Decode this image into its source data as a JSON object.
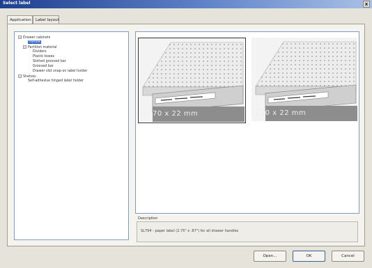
{
  "window": {
    "title": "Select label",
    "close_label": "x"
  },
  "tabs": [
    {
      "label": "Application",
      "active": true
    },
    {
      "label": "Label layout",
      "active": false
    }
  ],
  "tree": [
    {
      "label": "Drawer cabinets",
      "expander": "−"
    },
    {
      "label": "Handle",
      "selected": true
    },
    {
      "label": "Partition material",
      "expander": "−"
    },
    {
      "label": "Dividers"
    },
    {
      "label": "Plastic boxes"
    },
    {
      "label": "Slotted grooved bar"
    },
    {
      "label": "Grooved bar"
    },
    {
      "label": "Drawer slot snap-on label holder"
    },
    {
      "label": "Shelves",
      "expander": "−"
    },
    {
      "label": "Self-adhesive hinged label holder"
    }
  ],
  "previews": [
    {
      "size_label": "70 x 22 mm",
      "selected": true
    },
    {
      "size_label": "210 x 22 mm",
      "selected": false
    }
  ],
  "description": {
    "label": "Description",
    "text": "SL794 - paper label (2.75\" x .87\") for all drawer handles"
  },
  "buttons": {
    "open": "Open...",
    "ok": "OK",
    "cancel": "Cancel"
  }
}
